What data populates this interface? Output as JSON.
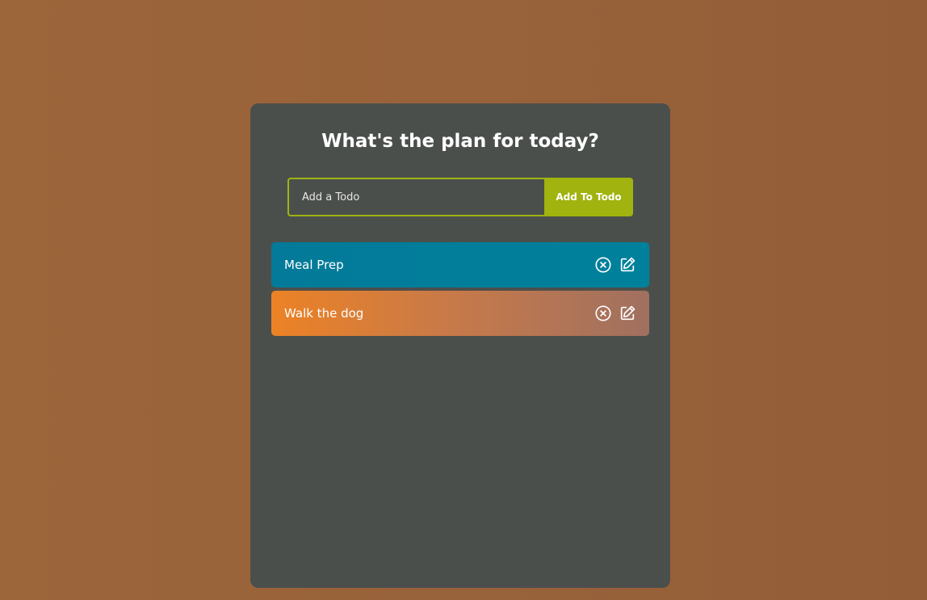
{
  "app": {
    "title": "What's the plan for today?"
  },
  "form": {
    "input_placeholder": "Add a Todo",
    "input_value": "",
    "button_label": "Add To Todo"
  },
  "todos": [
    {
      "text": "Meal Prep",
      "delete_icon": "close-circle-icon",
      "edit_icon": "edit-icon"
    },
    {
      "text": "Walk the dog",
      "delete_icon": "close-circle-icon",
      "edit_icon": "edit-icon"
    }
  ],
  "colors": {
    "background": "#98623a",
    "panel": "#4b4f4c",
    "accent": "#a0b30f",
    "todo_1": "#00819b",
    "todo_2": "#ec8225"
  }
}
